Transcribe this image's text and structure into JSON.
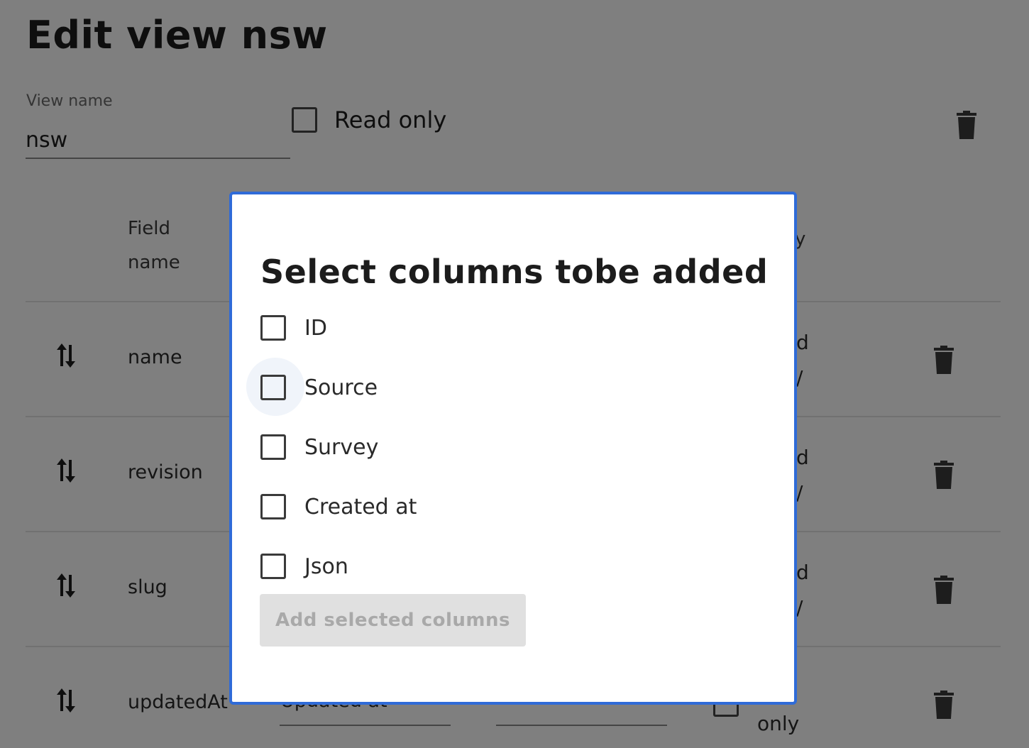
{
  "page": {
    "title": "Edit view nsw",
    "view_name_label": "View name",
    "view_name_value": "nsw",
    "read_only_label": "Read only"
  },
  "table": {
    "header_field": "Field\nname",
    "header_readonly_fragment": "y",
    "rows": [
      {
        "field": "name",
        "ro_fragment": "d\n/"
      },
      {
        "field": "revision",
        "ro_fragment": "d\n/"
      },
      {
        "field": "slug",
        "ro_fragment": "d\n/"
      },
      {
        "field": "updatedAt",
        "label": "Updated at",
        "ro_fragment": "d\nonly"
      }
    ]
  },
  "modal": {
    "title": "Select columns tobe added",
    "options": [
      {
        "label": "ID",
        "checked": false
      },
      {
        "label": "Source",
        "checked": false
      },
      {
        "label": "Survey",
        "checked": false
      },
      {
        "label": "Created at",
        "checked": false
      },
      {
        "label": "Json",
        "checked": false
      }
    ],
    "add_button_label": "Add selected columns",
    "add_button_disabled": true
  },
  "colors": {
    "modal_border": "#2f6bd8",
    "overlay": "rgba(0,0,0,0.5)",
    "button_disabled_bg": "#e0e0e0",
    "button_disabled_text": "#a9a9a9"
  },
  "icons": [
    "trash-icon",
    "sort-icon"
  ]
}
